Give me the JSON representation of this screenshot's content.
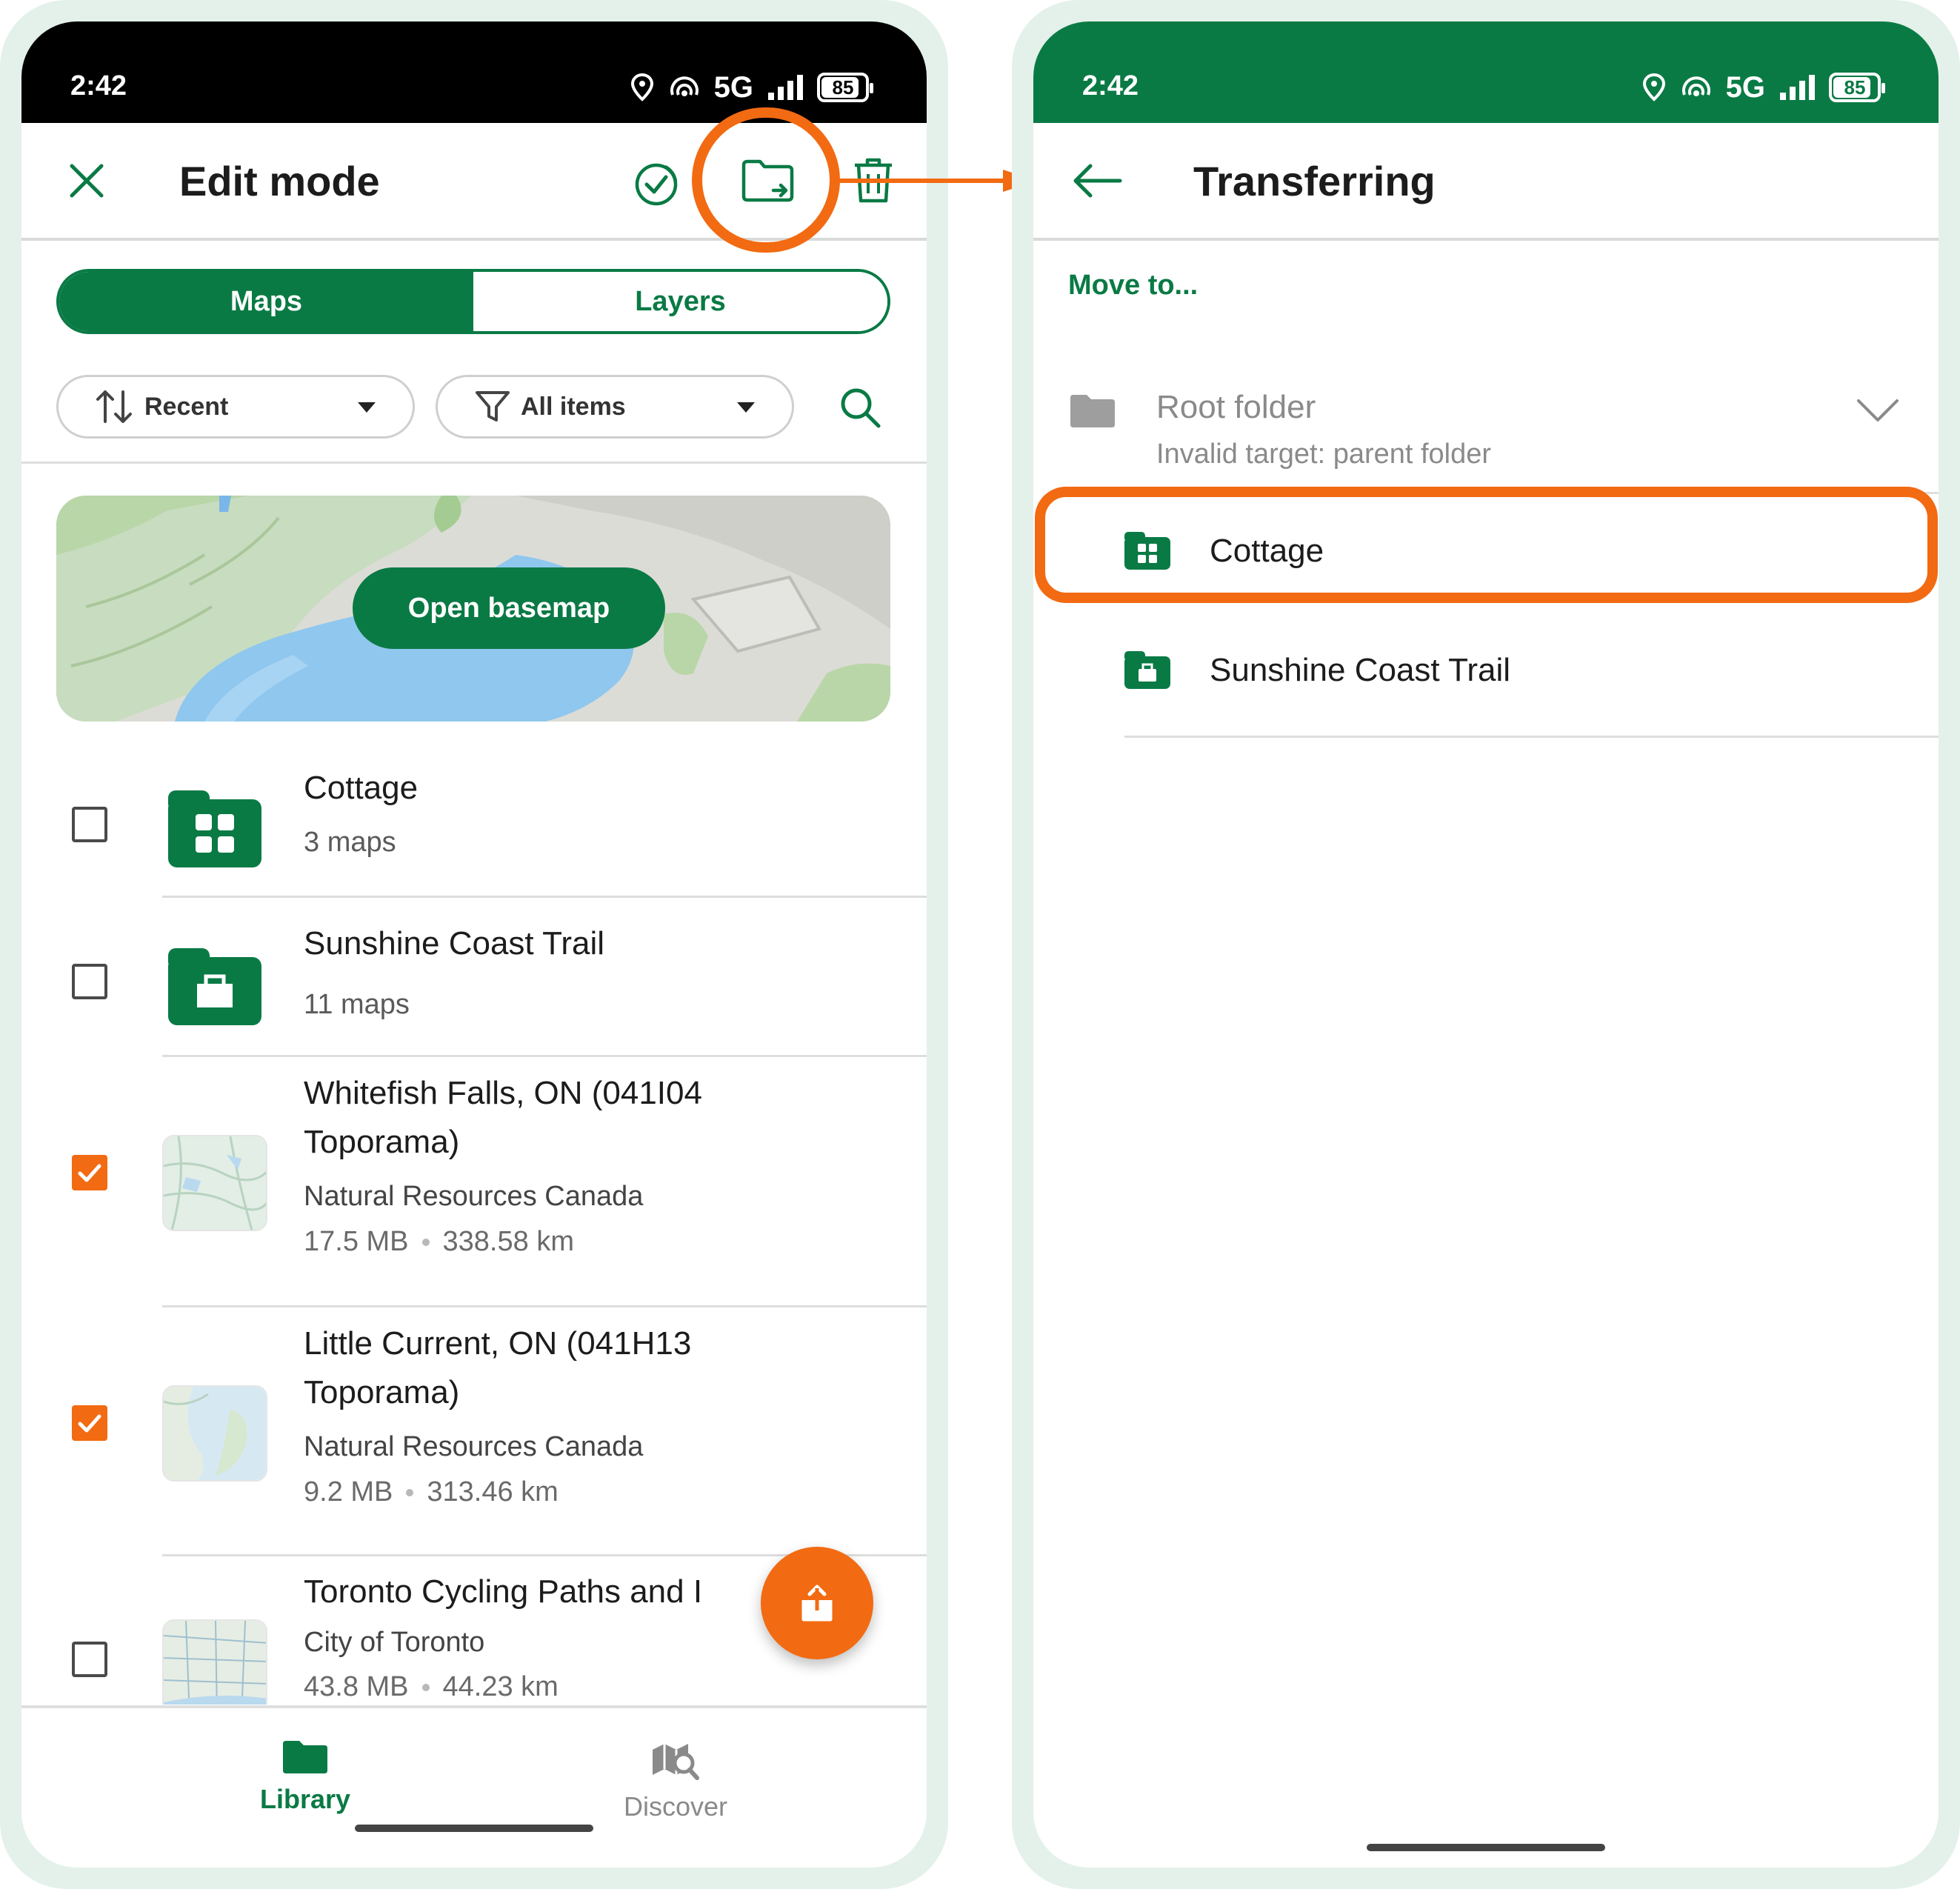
{
  "status_bar": {
    "time": "2:42",
    "network": "5G",
    "battery": "85"
  },
  "edit_screen": {
    "title": "Edit mode",
    "tabs": {
      "maps": "Maps",
      "layers": "Layers"
    },
    "sort_dropdown": "Recent",
    "filter_dropdown": "All items",
    "basemap_button": "Open basemap",
    "items": [
      {
        "title": "Cottage",
        "subtitle": "3 maps",
        "checked": false
      },
      {
        "title": "Sunshine Coast Trail",
        "subtitle": "11 maps",
        "checked": false
      },
      {
        "title_line1": "Whitefish Falls, ON (041I04",
        "title_line2": "Toporama)",
        "publisher": "Natural Resources Canada",
        "size": "17.5 MB",
        "area": "338.58 km",
        "checked": true
      },
      {
        "title_line1": "Little Current, ON (041H13",
        "title_line2": "Toporama)",
        "publisher": "Natural Resources Canada",
        "size": "9.2 MB",
        "area": "313.46 km",
        "checked": true
      },
      {
        "title": "Toronto Cycling Paths and I",
        "publisher": "City of Toronto",
        "size": "43.8 MB",
        "area": "44.23 km",
        "checked": false
      }
    ],
    "nav": {
      "library": "Library",
      "discover": "Discover"
    }
  },
  "transfer_screen": {
    "title": "Transferring",
    "section_label": "Move to...",
    "root_folder": {
      "label": "Root folder",
      "note": "Invalid target: parent folder"
    },
    "targets": [
      "Cottage",
      "Sunshine Coast Trail"
    ]
  },
  "colors": {
    "brand_green": "#0a7a45",
    "accent_orange": "#f26a12",
    "frame_mint": "#e3f1ea"
  }
}
